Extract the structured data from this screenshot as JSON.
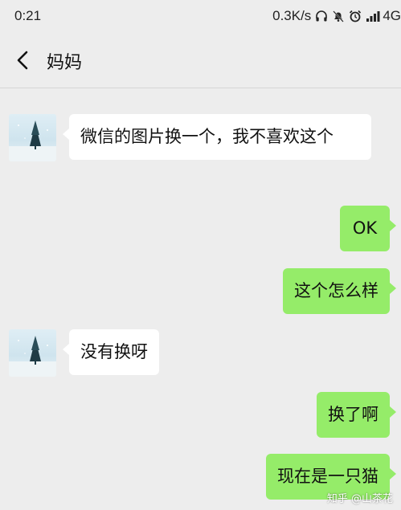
{
  "status_bar": {
    "time": "0:21",
    "network_speed": "0.3K/s",
    "signal": "4G"
  },
  "header": {
    "title": "妈妈"
  },
  "messages": [
    {
      "from": "incoming",
      "text": "微信的图片换一个，我不喜欢这个"
    },
    {
      "from": "outgoing",
      "text": "OK"
    },
    {
      "from": "outgoing",
      "text": "这个怎么样"
    },
    {
      "from": "incoming",
      "text": "没有换呀"
    },
    {
      "from": "outgoing",
      "text": "换了啊"
    },
    {
      "from": "outgoing",
      "text": "现在是一只猫"
    }
  ],
  "watermark": "知乎 @山茶花",
  "colors": {
    "background": "#ededed",
    "outgoing_bubble": "#95ec69",
    "incoming_bubble": "#ffffff"
  },
  "icons": {
    "back": "chevron-left-icon",
    "avatar": "winter-tree-avatar"
  }
}
